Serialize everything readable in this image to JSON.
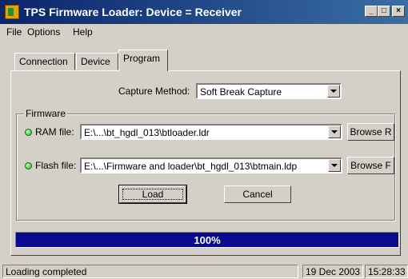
{
  "window": {
    "title": "TPS Firmware Loader:  Device = Receiver"
  },
  "menu": [
    "File",
    "Options",
    "Help"
  ],
  "tabs": [
    {
      "label": "Connection",
      "active": false
    },
    {
      "label": "Device",
      "active": false
    },
    {
      "label": "Program",
      "active": true
    }
  ],
  "capture": {
    "label": "Capture Method:",
    "value": "Soft Break Capture"
  },
  "firmware": {
    "title": "Firmware",
    "ram": {
      "label": "RAM file:",
      "value": "E:\\...\\bt_hgdl_013\\btloader.ldr",
      "browse": "Browse R"
    },
    "flash": {
      "label": "Flash file:",
      "value": "E:\\...\\Firmware and loader\\bt_hgdl_013\\btmain.ldp",
      "browse": "Browse F"
    },
    "status_color": "#22b022"
  },
  "buttons": {
    "load": "Load",
    "cancel": "Cancel"
  },
  "progress": {
    "value": 100,
    "text": "100%"
  },
  "status": {
    "message": "Loading completed",
    "date": "19 Dec 2003",
    "time": "15:28:33"
  }
}
